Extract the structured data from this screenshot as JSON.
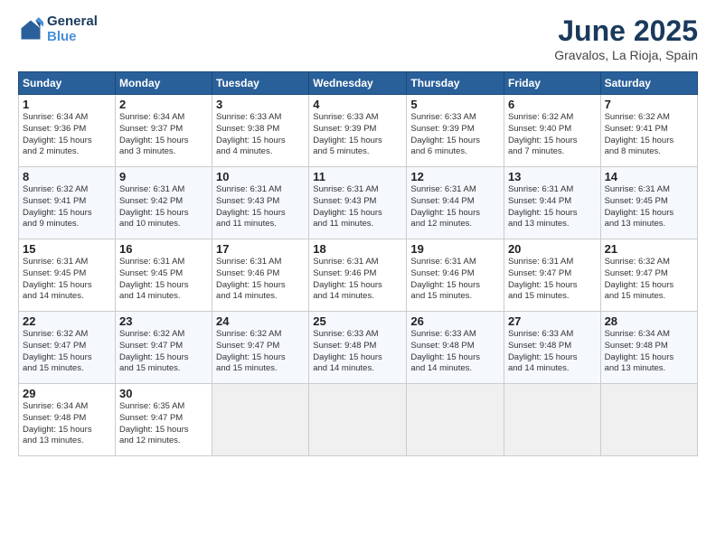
{
  "header": {
    "logo_line1": "General",
    "logo_line2": "Blue",
    "month_title": "June 2025",
    "location": "Gravalos, La Rioja, Spain"
  },
  "weekdays": [
    "Sunday",
    "Monday",
    "Tuesday",
    "Wednesday",
    "Thursday",
    "Friday",
    "Saturday"
  ],
  "weeks": [
    [
      {
        "day": "1",
        "info": "Sunrise: 6:34 AM\nSunset: 9:36 PM\nDaylight: 15 hours\nand 2 minutes."
      },
      {
        "day": "2",
        "info": "Sunrise: 6:34 AM\nSunset: 9:37 PM\nDaylight: 15 hours\nand 3 minutes."
      },
      {
        "day": "3",
        "info": "Sunrise: 6:33 AM\nSunset: 9:38 PM\nDaylight: 15 hours\nand 4 minutes."
      },
      {
        "day": "4",
        "info": "Sunrise: 6:33 AM\nSunset: 9:39 PM\nDaylight: 15 hours\nand 5 minutes."
      },
      {
        "day": "5",
        "info": "Sunrise: 6:33 AM\nSunset: 9:39 PM\nDaylight: 15 hours\nand 6 minutes."
      },
      {
        "day": "6",
        "info": "Sunrise: 6:32 AM\nSunset: 9:40 PM\nDaylight: 15 hours\nand 7 minutes."
      },
      {
        "day": "7",
        "info": "Sunrise: 6:32 AM\nSunset: 9:41 PM\nDaylight: 15 hours\nand 8 minutes."
      }
    ],
    [
      {
        "day": "8",
        "info": "Sunrise: 6:32 AM\nSunset: 9:41 PM\nDaylight: 15 hours\nand 9 minutes."
      },
      {
        "day": "9",
        "info": "Sunrise: 6:31 AM\nSunset: 9:42 PM\nDaylight: 15 hours\nand 10 minutes."
      },
      {
        "day": "10",
        "info": "Sunrise: 6:31 AM\nSunset: 9:43 PM\nDaylight: 15 hours\nand 11 minutes."
      },
      {
        "day": "11",
        "info": "Sunrise: 6:31 AM\nSunset: 9:43 PM\nDaylight: 15 hours\nand 11 minutes."
      },
      {
        "day": "12",
        "info": "Sunrise: 6:31 AM\nSunset: 9:44 PM\nDaylight: 15 hours\nand 12 minutes."
      },
      {
        "day": "13",
        "info": "Sunrise: 6:31 AM\nSunset: 9:44 PM\nDaylight: 15 hours\nand 13 minutes."
      },
      {
        "day": "14",
        "info": "Sunrise: 6:31 AM\nSunset: 9:45 PM\nDaylight: 15 hours\nand 13 minutes."
      }
    ],
    [
      {
        "day": "15",
        "info": "Sunrise: 6:31 AM\nSunset: 9:45 PM\nDaylight: 15 hours\nand 14 minutes."
      },
      {
        "day": "16",
        "info": "Sunrise: 6:31 AM\nSunset: 9:45 PM\nDaylight: 15 hours\nand 14 minutes."
      },
      {
        "day": "17",
        "info": "Sunrise: 6:31 AM\nSunset: 9:46 PM\nDaylight: 15 hours\nand 14 minutes."
      },
      {
        "day": "18",
        "info": "Sunrise: 6:31 AM\nSunset: 9:46 PM\nDaylight: 15 hours\nand 14 minutes."
      },
      {
        "day": "19",
        "info": "Sunrise: 6:31 AM\nSunset: 9:46 PM\nDaylight: 15 hours\nand 15 minutes."
      },
      {
        "day": "20",
        "info": "Sunrise: 6:31 AM\nSunset: 9:47 PM\nDaylight: 15 hours\nand 15 minutes."
      },
      {
        "day": "21",
        "info": "Sunrise: 6:32 AM\nSunset: 9:47 PM\nDaylight: 15 hours\nand 15 minutes."
      }
    ],
    [
      {
        "day": "22",
        "info": "Sunrise: 6:32 AM\nSunset: 9:47 PM\nDaylight: 15 hours\nand 15 minutes."
      },
      {
        "day": "23",
        "info": "Sunrise: 6:32 AM\nSunset: 9:47 PM\nDaylight: 15 hours\nand 15 minutes."
      },
      {
        "day": "24",
        "info": "Sunrise: 6:32 AM\nSunset: 9:47 PM\nDaylight: 15 hours\nand 15 minutes."
      },
      {
        "day": "25",
        "info": "Sunrise: 6:33 AM\nSunset: 9:48 PM\nDaylight: 15 hours\nand 14 minutes."
      },
      {
        "day": "26",
        "info": "Sunrise: 6:33 AM\nSunset: 9:48 PM\nDaylight: 15 hours\nand 14 minutes."
      },
      {
        "day": "27",
        "info": "Sunrise: 6:33 AM\nSunset: 9:48 PM\nDaylight: 15 hours\nand 14 minutes."
      },
      {
        "day": "28",
        "info": "Sunrise: 6:34 AM\nSunset: 9:48 PM\nDaylight: 15 hours\nand 13 minutes."
      }
    ],
    [
      {
        "day": "29",
        "info": "Sunrise: 6:34 AM\nSunset: 9:48 PM\nDaylight: 15 hours\nand 13 minutes."
      },
      {
        "day": "30",
        "info": "Sunrise: 6:35 AM\nSunset: 9:47 PM\nDaylight: 15 hours\nand 12 minutes."
      },
      {
        "day": "",
        "info": ""
      },
      {
        "day": "",
        "info": ""
      },
      {
        "day": "",
        "info": ""
      },
      {
        "day": "",
        "info": ""
      },
      {
        "day": "",
        "info": ""
      }
    ]
  ]
}
